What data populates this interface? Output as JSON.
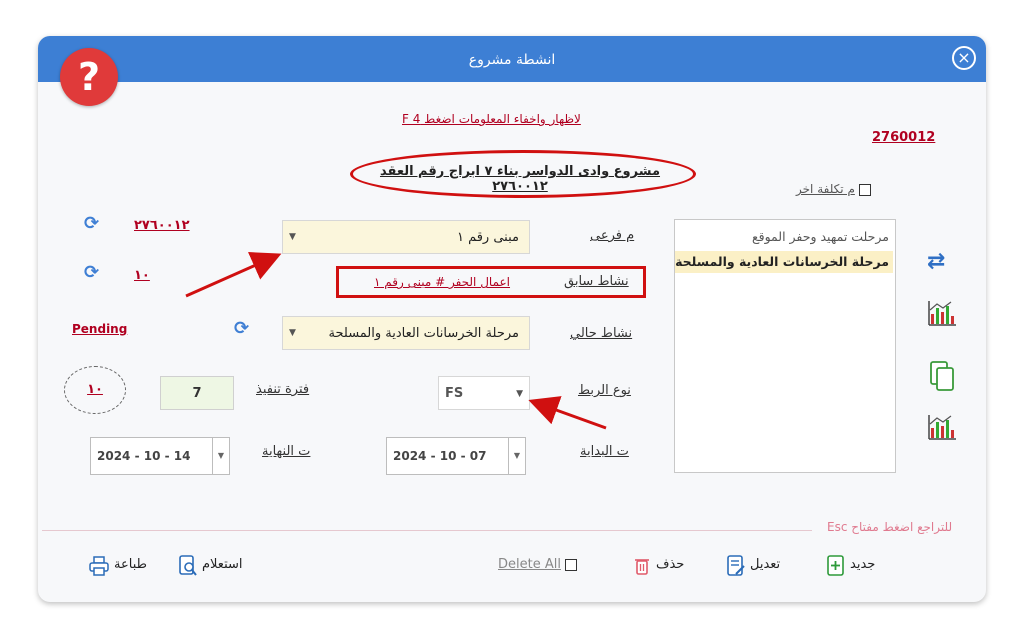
{
  "window": {
    "title": "انشطة مشروع",
    "close_glyph": "×"
  },
  "help_badge_glyph": "?",
  "info_toggle_hint": "لاظهار  واخفاء المعلومات اضغط F 4",
  "project_number": "2760012",
  "project_name": "مشروع وادى الدواسر بناء ٧ ابراج رقم العقد ٢٧٦٠٠١٢",
  "other_cost_label": "م تكلفة اخر",
  "side_codes": {
    "code1": "٢٧٦٠٠١٢",
    "code2": "١٠"
  },
  "status": "Pending",
  "fields": {
    "sub_label": "م فرعى",
    "sub_value": "مبنى رقم ١",
    "prev_activity_label": "نشاط سابق",
    "prev_activity_value": "اعمال الحفر # مبنى رقم ١",
    "current_activity_label": "نشاط حالي",
    "current_activity_value": "مرحلة الخرسانات العادية والمسلحة",
    "link_type_label": "نوع الربط",
    "link_type_value": "FS",
    "duration_label": "فترة تنفيذ",
    "duration_value": "7",
    "circle_value": "١٠",
    "start_label": "ت البداية",
    "start_value": "2024 - 10 - 07",
    "end_label": "ت النهاية",
    "end_value": "2024 - 10 - 14"
  },
  "activities_list": [
    {
      "label": "مرحلت تمهيد وحفر الموقع",
      "selected": false
    },
    {
      "label": "مرحلة الخرسانات العادية والمسلحة",
      "selected": true
    }
  ],
  "esc_hint": "للتراجع اضغط مفتاح Esc",
  "toolbar": {
    "new_label": "جديد",
    "edit_label": "تعديل",
    "delete_label": "حذف",
    "delete_all_label": "Delete All",
    "query_label": "استعلام",
    "print_label": "طباعة"
  },
  "colors": {
    "titlebar": "#3d7fd4",
    "accent_red": "#b00020",
    "annotation_red": "#d01010",
    "selected_row": "#fbf0c6"
  }
}
